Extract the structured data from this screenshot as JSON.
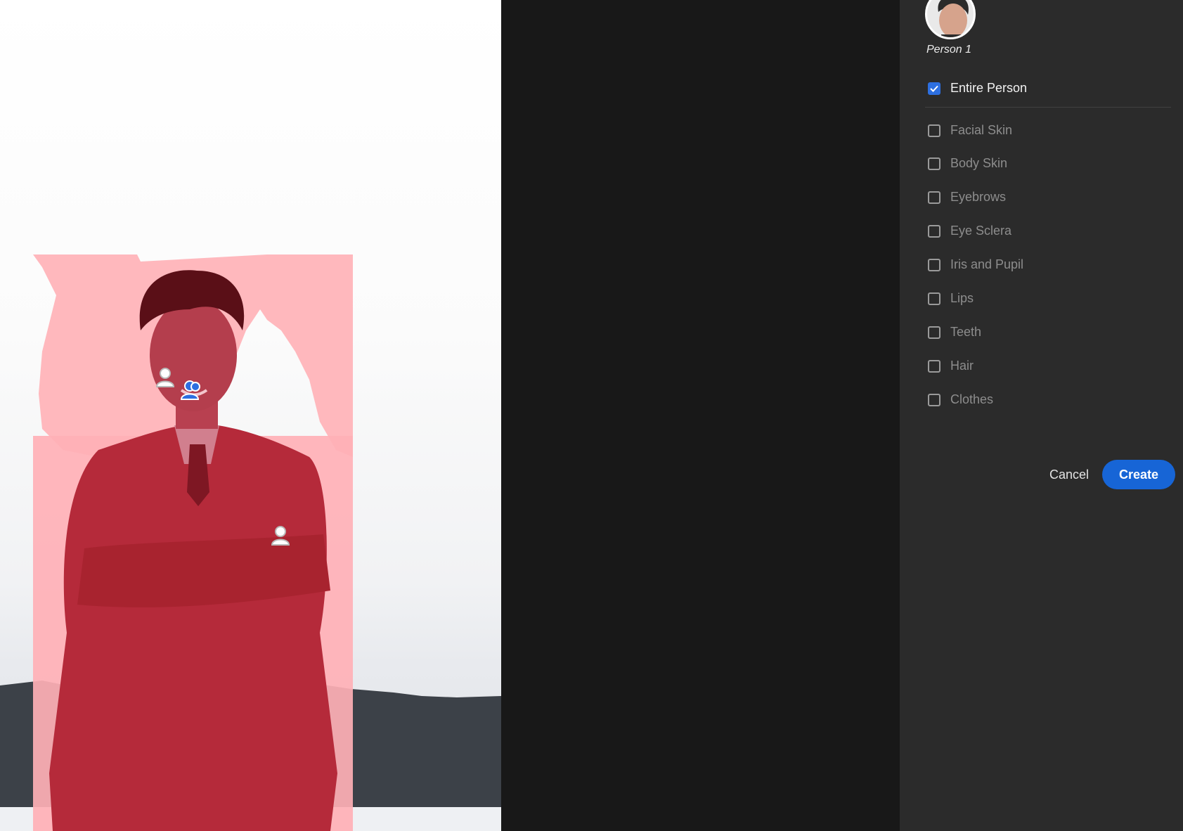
{
  "person": {
    "label": "Person 1"
  },
  "options": [
    {
      "label": "Entire Person",
      "checked": true
    },
    {
      "label": "Facial Skin",
      "checked": false
    },
    {
      "label": "Body Skin",
      "checked": false
    },
    {
      "label": "Eyebrows",
      "checked": false
    },
    {
      "label": "Eye Sclera",
      "checked": false
    },
    {
      "label": "Iris and Pupil",
      "checked": false
    },
    {
      "label": "Lips",
      "checked": false
    },
    {
      "label": "Teeth",
      "checked": false
    },
    {
      "label": "Hair",
      "checked": false
    },
    {
      "label": "Clothes",
      "checked": false
    }
  ],
  "actions": {
    "cancel": "Cancel",
    "create": "Create"
  },
  "colors": {
    "accent": "#1765d6",
    "mask_overlay": "#ff6f78",
    "panel_bg": "#2b2b2b"
  },
  "pins": [
    {
      "icon": "person-pin-icon",
      "selected": false
    },
    {
      "icon": "people-pin-icon",
      "selected": true
    },
    {
      "icon": "person-pin-icon",
      "selected": false
    }
  ]
}
